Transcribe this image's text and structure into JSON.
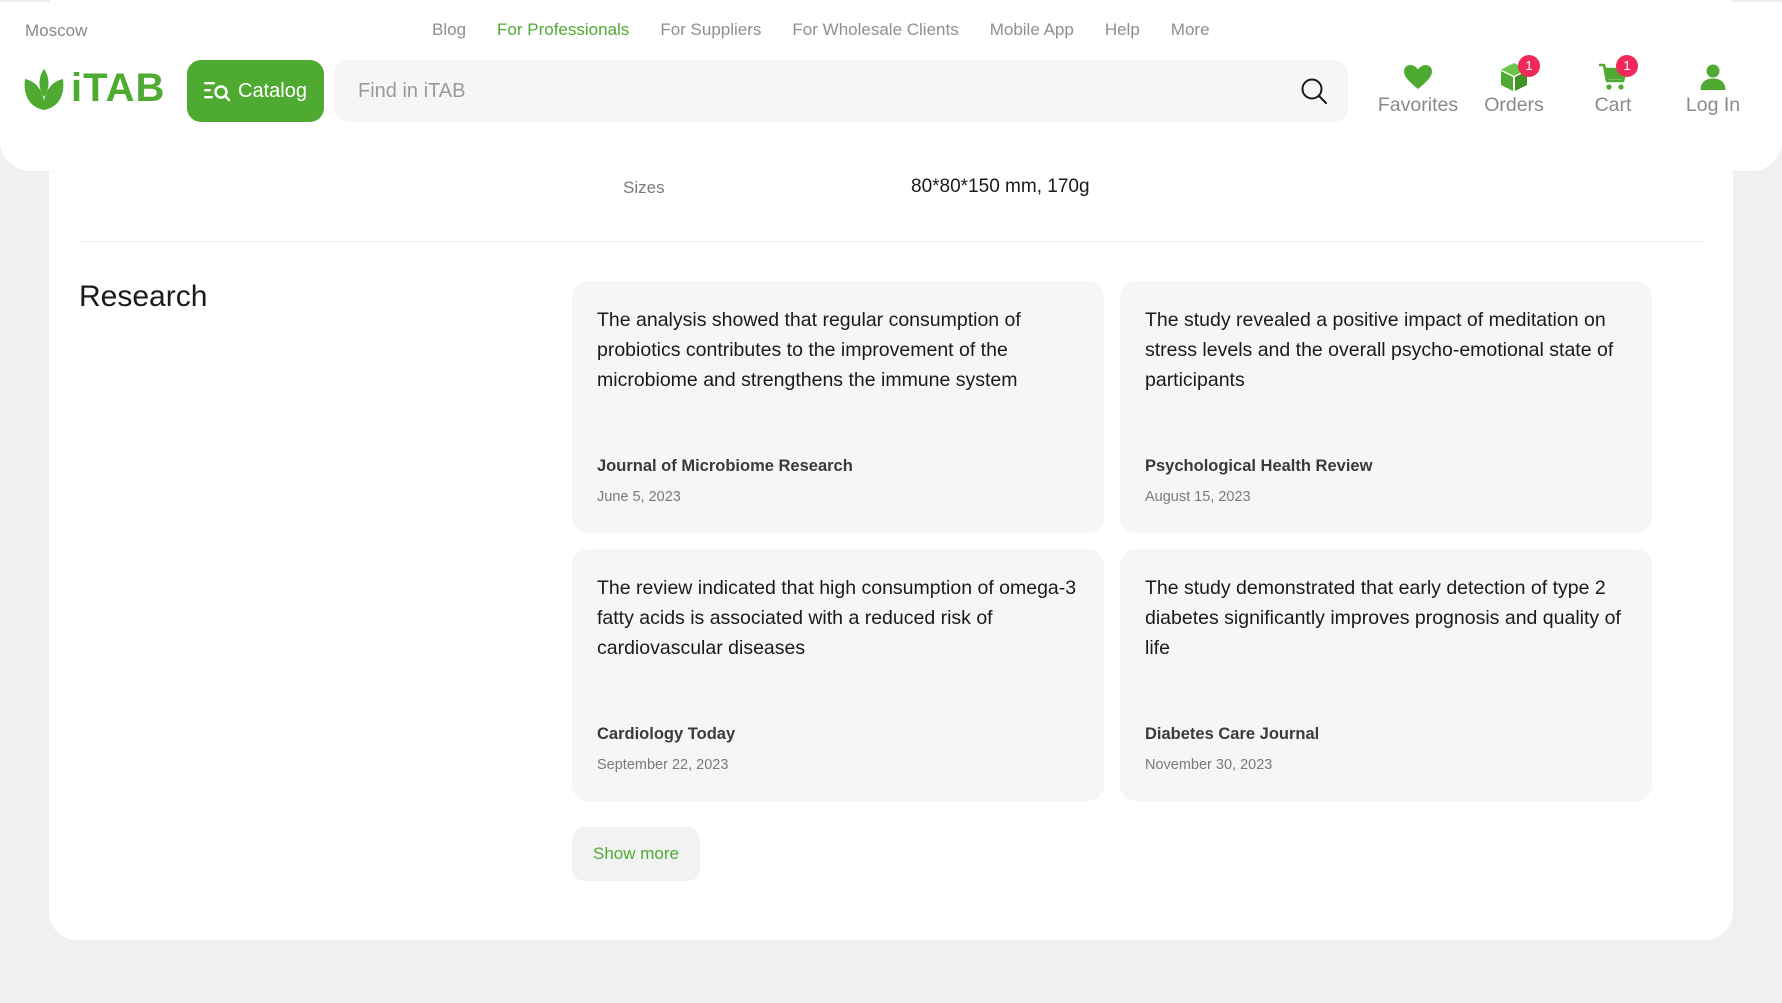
{
  "header": {
    "city": "Moscow",
    "nav": [
      {
        "label": "Blog",
        "active": false
      },
      {
        "label": "For Professionals",
        "active": true
      },
      {
        "label": "For Suppliers",
        "active": false
      },
      {
        "label": "For Wholesale Clients",
        "active": false
      },
      {
        "label": "Mobile App",
        "active": false
      },
      {
        "label": "Help",
        "active": false
      },
      {
        "label": "More",
        "active": false
      }
    ],
    "logo_text": "iTAB",
    "catalog_label": "Catalog",
    "search_placeholder": "Find in iTAB",
    "actions": {
      "favorites": {
        "label": "Favorites",
        "icon": "heart-icon"
      },
      "orders": {
        "label": "Orders",
        "icon": "box-icon",
        "badge": "1"
      },
      "cart": {
        "label": "Cart",
        "icon": "cart-icon",
        "badge": "1"
      },
      "login": {
        "label": "Log In",
        "icon": "user-icon"
      }
    }
  },
  "specs": {
    "sizes_label": "Sizes",
    "sizes_value": "80*80*150 mm, 170g"
  },
  "research": {
    "title": "Research",
    "cards": [
      {
        "text": "The analysis showed that regular consumption of probiotics contributes to the improvement of the microbiome and strengthens the immune system",
        "journal": "Journal of Microbiome Research",
        "date": "June 5, 2023"
      },
      {
        "text": "The study revealed a positive impact of meditation on stress levels and the overall psycho-emotional state of participants",
        "journal": "Psychological Health Review",
        "date": "August 15, 2023"
      },
      {
        "text": "The review indicated that high consumption of omega-3 fatty acids is associated with a reduced risk of cardiovascular diseases",
        "journal": "Cardiology Today",
        "date": "September 22, 2023"
      },
      {
        "text": "The study demonstrated that early detection of type 2 diabetes significantly improves prognosis and quality of life",
        "journal": "Diabetes Care Journal",
        "date": "November 30, 2023"
      }
    ],
    "show_more_label": "Show more"
  },
  "colors": {
    "brand": "#4faa32",
    "badge": "#f0295a",
    "muted_text": "#8a8a8a",
    "page_bg": "#f0f0f0"
  }
}
